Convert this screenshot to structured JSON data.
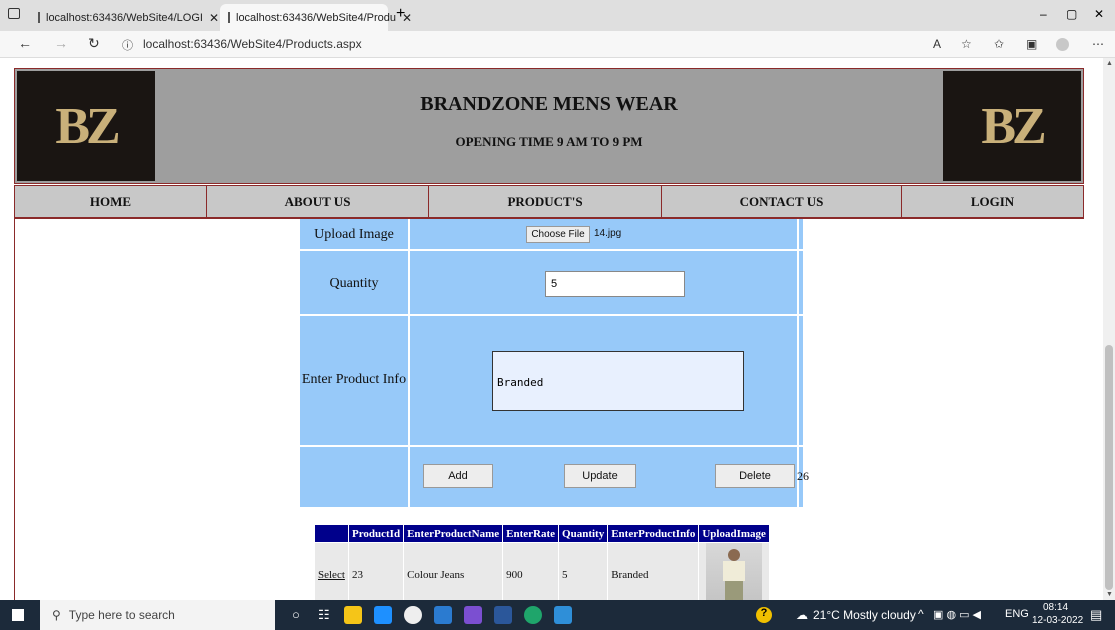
{
  "browser": {
    "tab1": "localhost:63436/WebSite4/LOGI",
    "tab2": "localhost:63436/WebSite4/Produ",
    "url": "localhost:63436/WebSite4/Products.aspx"
  },
  "header": {
    "logo": "BZ",
    "title": "BRANDZONE MENS WEAR",
    "subtitle": "OPENING TIME 9 AM TO 9 PM"
  },
  "nav": [
    "HOME",
    "ABOUT US",
    "PRODUCT'S",
    "CONTACT US",
    "LOGIN"
  ],
  "form": {
    "upload_label": "Upload Image",
    "choose_file": "Choose File",
    "file_name": "14.jpg",
    "quantity_label": "Quantity",
    "quantity_value": "5",
    "info_label": "Enter Product Info",
    "info_value": "Branded",
    "add": "Add",
    "update": "Update",
    "delete": "Delete",
    "id_value": "26"
  },
  "grid": {
    "headers": [
      "ProductId",
      "EnterProductName",
      "EnterRate",
      "Quantity",
      "EnterProductInfo",
      "UploadImage"
    ],
    "rows": [
      {
        "select": "Select",
        "id": "23",
        "name": "Colour Jeans",
        "rate": "900",
        "qty": "5",
        "info": "Branded"
      }
    ]
  },
  "taskbar": {
    "search": "Type here to search",
    "weather": "21°C  Mostly cloudy",
    "lang": "ENG",
    "time": "08:14",
    "date": "12-03-2022"
  }
}
